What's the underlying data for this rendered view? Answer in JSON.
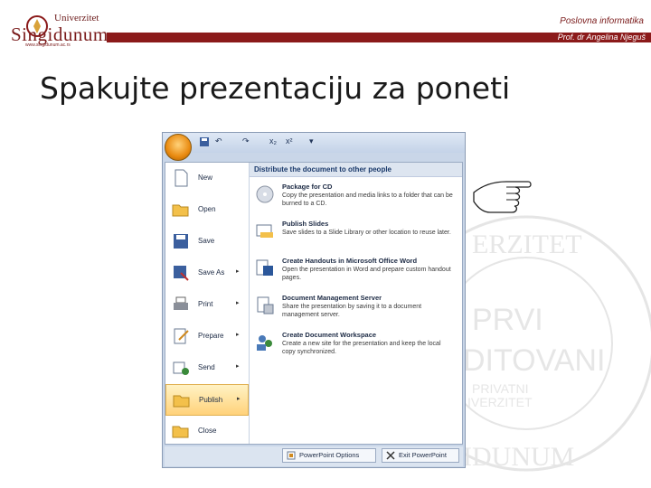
{
  "header": {
    "logo_top": "Univerzitet",
    "logo_main": "Singidunum",
    "logo_url": "www.singidunum.ac.rs",
    "course": "Poslovna informatika",
    "author": "Prof. dr Angelina Njeguš",
    "accent_color": "#8b1a1a"
  },
  "slide": {
    "title": "Spakujte prezentaciju za poneti"
  },
  "watermark": {
    "text_1": "ERZITET",
    "text_2": "PRVI",
    "text_3": "DITOVANI",
    "text_4": "PRIVATNI",
    "text_5": "IVERZITET",
    "text_6": "IDUNUM"
  },
  "office_menu": {
    "items": [
      {
        "label": "New",
        "icon": "new-document-icon"
      },
      {
        "label": "Open",
        "icon": "folder-open-icon"
      },
      {
        "label": "Save",
        "icon": "floppy-disk-icon"
      },
      {
        "label": "Save As",
        "icon": "save-as-icon",
        "arrow": "▸"
      },
      {
        "label": "Print",
        "icon": "printer-icon",
        "arrow": "▸"
      },
      {
        "label": "Prepare",
        "icon": "prepare-icon",
        "arrow": "▸"
      },
      {
        "label": "Send",
        "icon": "send-icon",
        "arrow": "▸"
      },
      {
        "label": "Publish",
        "icon": "publish-icon",
        "arrow": "▸",
        "active": true
      },
      {
        "label": "Close",
        "icon": "close-folder-icon"
      }
    ],
    "submenu_header": "Distribute the document to other people",
    "submenu_items": [
      {
        "title": "Package for CD",
        "desc": "Copy the presentation and media links to a folder that can be burned to a CD.",
        "icon": "cd-icon"
      },
      {
        "title": "Publish Slides",
        "desc": "Save slides to a Slide Library or other location to reuse later.",
        "icon": "slides-library-icon"
      },
      {
        "title": "Create Handouts in Microsoft Office Word",
        "desc": "Open the presentation in Word and prepare custom handout pages.",
        "icon": "word-handouts-icon"
      },
      {
        "title": "Document Management Server",
        "desc": "Share the presentation by saving it to a document management server.",
        "icon": "server-icon"
      },
      {
        "title": "Create Document Workspace",
        "desc": "Create a new site for the presentation and keep the local copy synchronized.",
        "icon": "workspace-icon"
      }
    ],
    "bottom_buttons": [
      {
        "label": "PowerPoint Options",
        "icon": "options-icon"
      },
      {
        "label": "Exit PowerPoint",
        "icon": "exit-x-icon"
      }
    ]
  },
  "qat": {
    "undo": "↶",
    "redo": "↷",
    "subscript": "x₂",
    "superscript": "x²",
    "customize": "▾"
  }
}
